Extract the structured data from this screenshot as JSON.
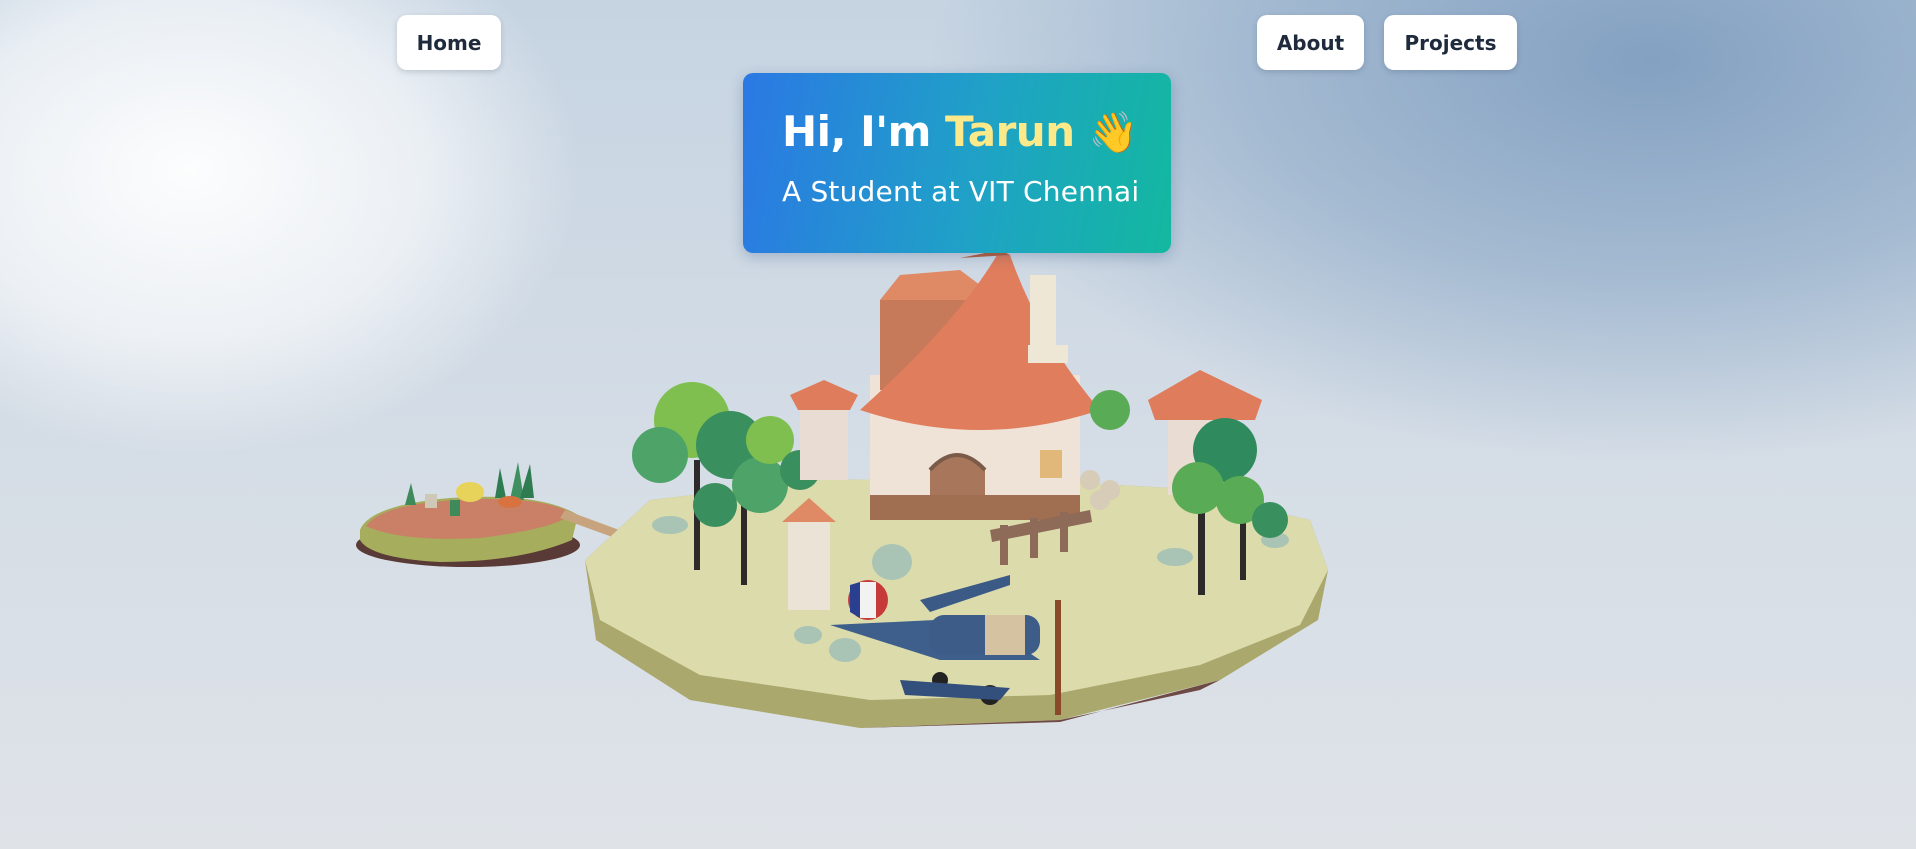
{
  "nav": {
    "home_label": "Home",
    "about_label": "About",
    "projects_label": "Projects"
  },
  "intro": {
    "greeting": "Hi, I'm ",
    "name": "Tarun",
    "wave": "👋",
    "subtitle": "A Student at VIT Chennai"
  },
  "scene": {
    "description_icon": "island-3d-scene",
    "plane_icon": "biplane-icon",
    "house_icon": "cottage-icon"
  },
  "colors": {
    "card_gradient_start": "#2b78e4",
    "card_gradient_end": "#13b8a0",
    "name_highlight": "#fce98a",
    "nav_text": "#1f2a3c"
  }
}
